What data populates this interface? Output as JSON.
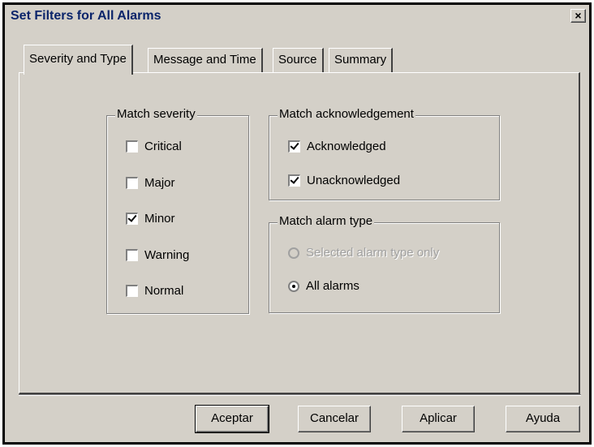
{
  "window": {
    "title": "Set Filters for All Alarms",
    "close_glyph": "×"
  },
  "tabs": [
    {
      "label": "Severity and Type",
      "active": true
    },
    {
      "label": "Message and Time",
      "active": false
    },
    {
      "label": "Source",
      "active": false
    },
    {
      "label": "Summary",
      "active": false
    }
  ],
  "severity": {
    "title": "Match severity",
    "items": [
      {
        "label": "Critical",
        "checked": false
      },
      {
        "label": "Major",
        "checked": false
      },
      {
        "label": "Minor",
        "checked": true
      },
      {
        "label": "Warning",
        "checked": false
      },
      {
        "label": "Normal",
        "checked": false
      }
    ]
  },
  "acknowledgement": {
    "title": "Match acknowledgement",
    "items": [
      {
        "label": "Acknowledged",
        "checked": true
      },
      {
        "label": "Unacknowledged",
        "checked": true
      }
    ]
  },
  "alarm_type": {
    "title": "Match alarm type",
    "options": [
      {
        "label": "Selected alarm type only",
        "selected": false,
        "enabled": false
      },
      {
        "label": "All alarms",
        "selected": true,
        "enabled": true
      }
    ]
  },
  "buttons": {
    "ok": "Aceptar",
    "cancel": "Cancelar",
    "apply": "Aplicar",
    "help": "Ayuda"
  }
}
